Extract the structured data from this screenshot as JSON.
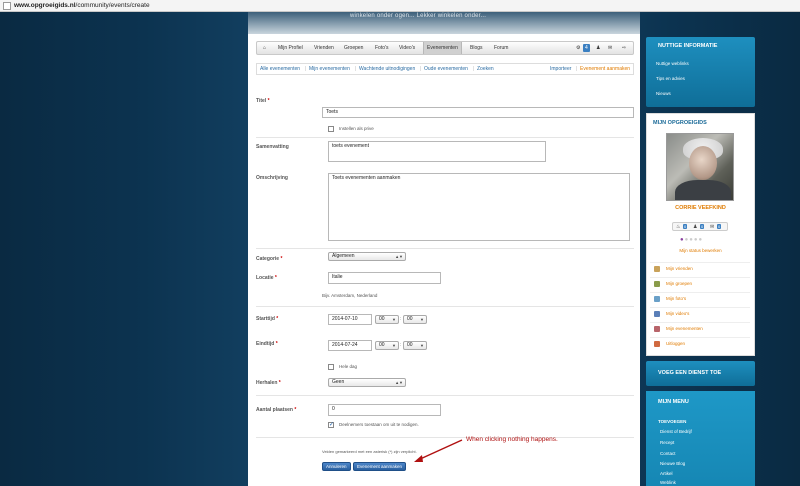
{
  "browser": {
    "url_domain": "www.opgroeigids.nl",
    "url_path": "/community/events/create"
  },
  "banner": {
    "text": "winkelen onder ogen... Lekker winkelen onder..."
  },
  "nav": {
    "items": [
      "Mijn Profiel",
      "Vrienden",
      "Groepen",
      "Foto's",
      "Video's",
      "Evenementen",
      "Blogs",
      "Forum"
    ],
    "active": "Evenementen",
    "notification_count": "4"
  },
  "subnav": {
    "items": [
      "Alle evenementen",
      "Mijn evenementen",
      "Wachtende uitnodigingen",
      "Oude evenementen",
      "Zoeken"
    ],
    "import": "Importeer",
    "create": "Evenement aanmaken"
  },
  "form": {
    "title_label": "Titel",
    "title_value": "Toets",
    "private_label": "Instellen als prive",
    "summary_label": "Samenvatting",
    "summary_value": "toets evenement",
    "description_label": "Omschrijving",
    "description_value": "Toets evenementen aanmaken",
    "category_label": "Categorie",
    "category_value": "Algemeen",
    "location_label": "Locatie",
    "location_value": "Italie",
    "location_hint": "Bijv. Amsterdam, Nederland",
    "start_label": "Starttijd",
    "start_date": "2014-07-10",
    "start_hour": "00",
    "start_min": "00",
    "end_label": "Eindtijd",
    "end_date": "2014-07-24",
    "end_hour": "00",
    "end_min": "00",
    "allday_label": "Hele dag",
    "repeat_label": "Herhalen",
    "repeat_value": "Geen",
    "seats_label": "Aantal plaatsen",
    "seats_value": "0",
    "invite_label": "Deelnemers toestaan om uit te nodigen.",
    "required_note": "Velden gemarkeerd met een asterisk (*) zijn verplicht.",
    "cancel_label": "Annuleren",
    "submit_label": "Evenement aanmaken",
    "required_mark": "*"
  },
  "annotation": {
    "text": "When clicking nothing happens."
  },
  "sidebar": {
    "info_title": "NUTTIGE INFORMATIE",
    "info_links": [
      "Nuttige weblinks",
      "Tips en advies",
      "Nieuws"
    ],
    "profile_title": "MIJN OPGROEIGIDS",
    "user_name": "CORRIE VEEFKIND",
    "badge_counts": [
      "0",
      "0",
      "0"
    ],
    "status_edit": "Mijn status bewerken",
    "menu_links": [
      "Mijn vrienden",
      "Mijn groepen",
      "Mijn foto's",
      "Mijn video's",
      "Mijn evenementen",
      "Uitloggen"
    ],
    "service_title": "VOEG EEN DIENST TOE",
    "menu_title": "MIJN MENU",
    "add_title": "TOEVOEGEN",
    "add_links": [
      "Dienst of Bedrijf",
      "Recept",
      "Contact",
      "Nieuwe Blog",
      "Artikel",
      "Weblink"
    ]
  }
}
